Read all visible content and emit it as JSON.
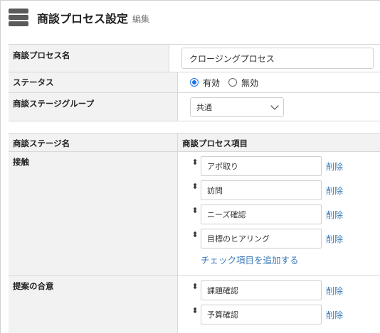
{
  "header": {
    "title": "商談プロセス設定",
    "subtitle": "編集"
  },
  "form": {
    "process_name_label": "商談プロセス名",
    "process_name_value": "クロージングプロセス",
    "status_label": "ステータス",
    "status_options": [
      {
        "label": "有効",
        "selected": true
      },
      {
        "label": "無効",
        "selected": false
      }
    ],
    "group_label": "商談ステージグループ",
    "group_value": "共通"
  },
  "stage_table": {
    "col_stage": "商談ステージ名",
    "col_items": "商談プロセス項目",
    "delete_label": "削除",
    "add_label": "チェック項目を追加する",
    "stages": [
      {
        "name": "接触",
        "items": [
          "アポ取り",
          "訪問",
          "ニーズ確認",
          "目標のヒアリング"
        ]
      },
      {
        "name": "提案の合意",
        "items": [
          "課題確認",
          "予算確認"
        ]
      }
    ]
  },
  "colors": {
    "link": "#3a7ab8",
    "radio_accent": "#1a73e8",
    "label_bg": "#f2f2f2"
  }
}
